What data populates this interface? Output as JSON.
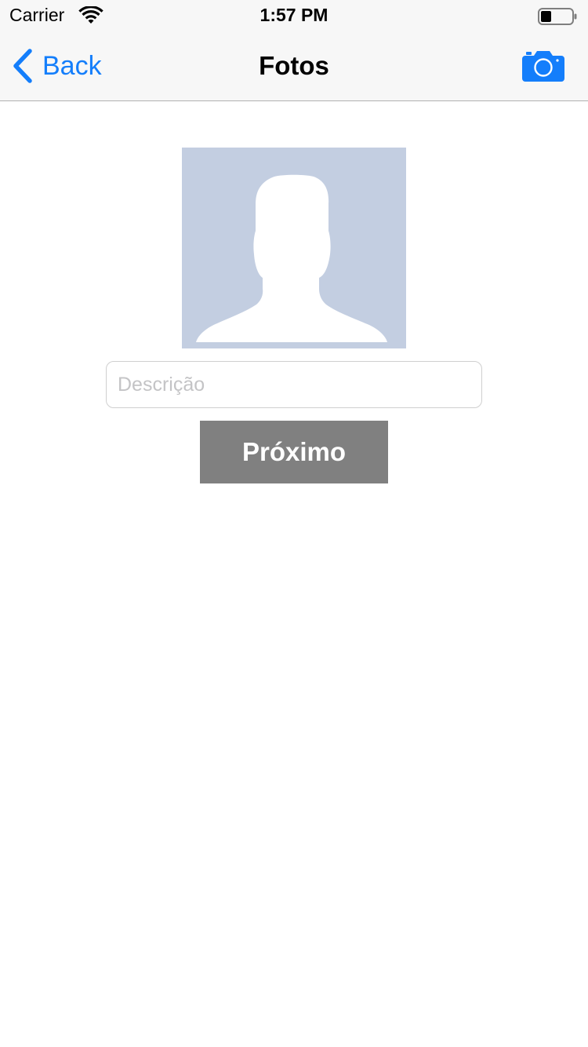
{
  "status_bar": {
    "carrier": "Carrier",
    "time": "1:57 PM",
    "wifi_icon": "wifi-icon",
    "battery_icon": "battery-icon"
  },
  "nav_bar": {
    "back_label": "Back",
    "title": "Fotos",
    "back_icon": "chevron-left-icon",
    "camera_icon": "camera-icon",
    "tint_color": "#147efb"
  },
  "content": {
    "photo_icon": "person-placeholder-icon",
    "description_placeholder": "Descrição",
    "description_value": "",
    "next_label": "Próximo",
    "next_button_color": "#808080"
  }
}
